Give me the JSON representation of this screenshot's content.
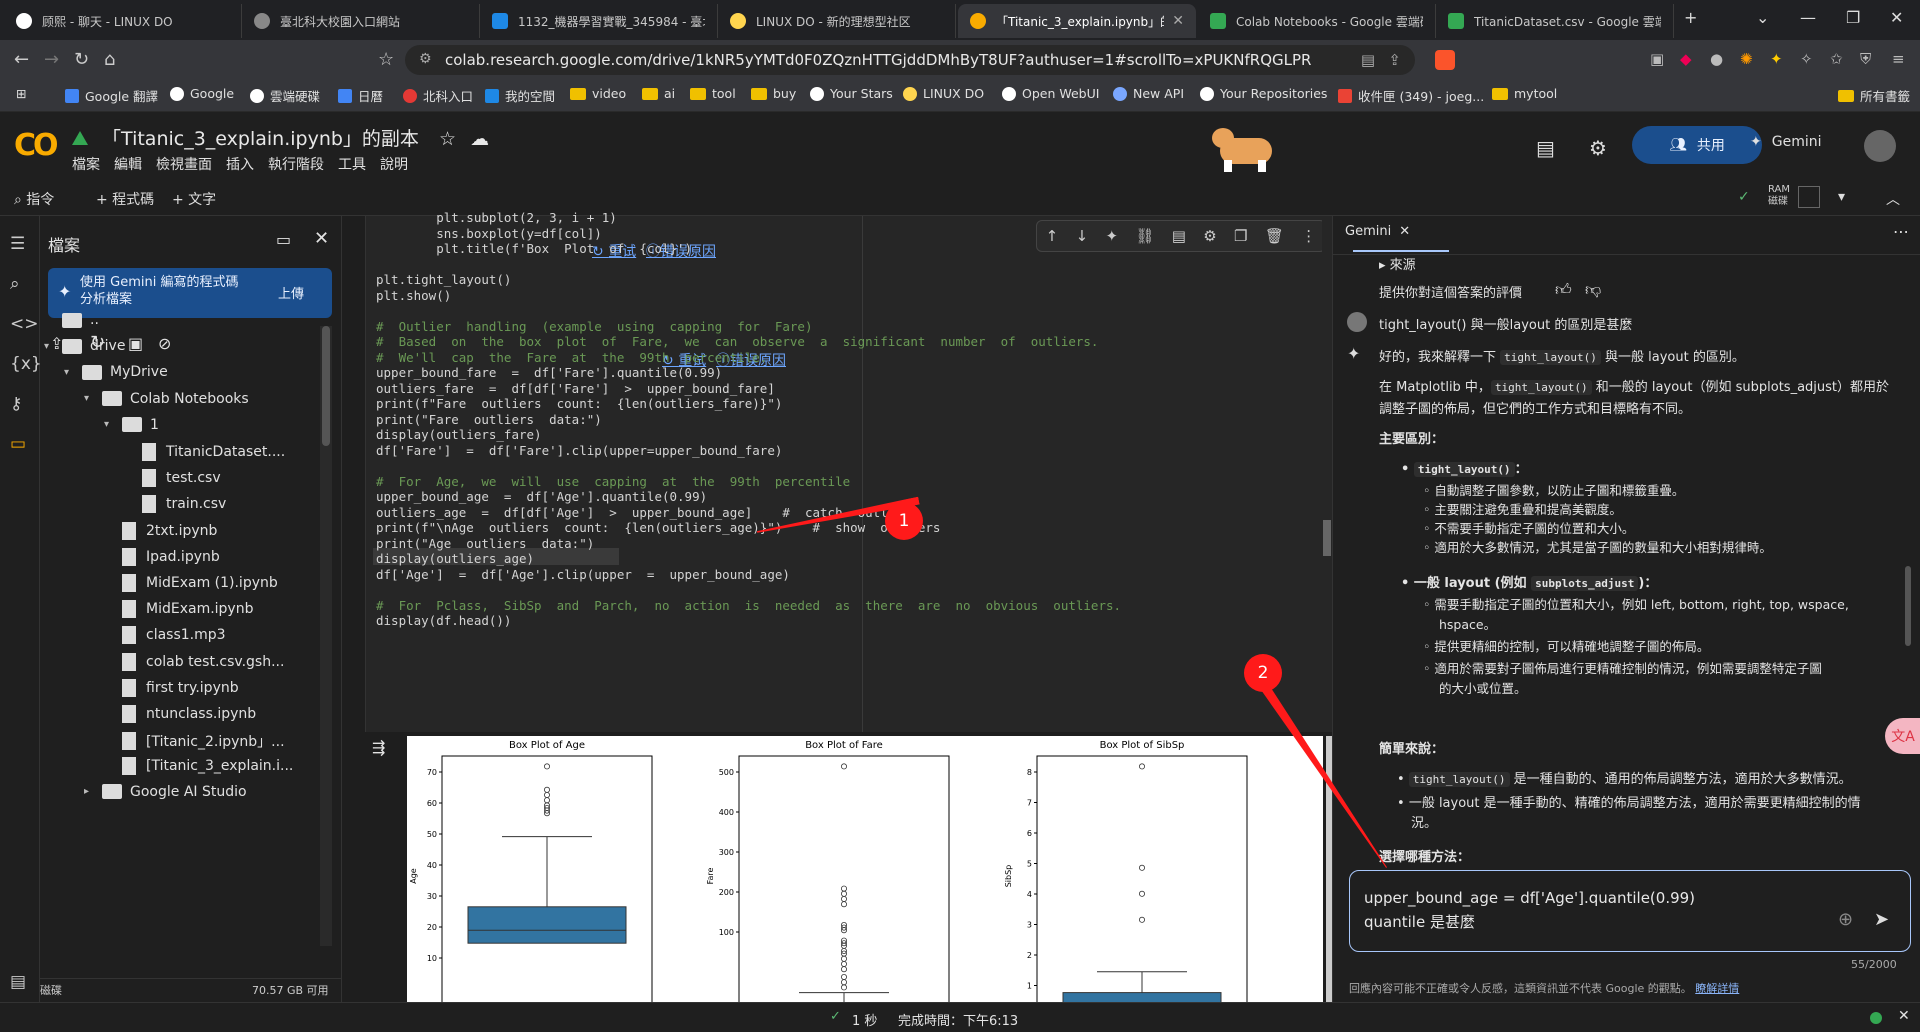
{
  "browser": {
    "tabs": [
      {
        "title": "顾熙 - 聊天 - LINUX DO",
        "color": "#ffffff"
      },
      {
        "title": "臺北科大校園入口網站",
        "color": "#888888"
      },
      {
        "title": "1132_機器學習實戰_345984 - 臺北",
        "color": "#1e88e5"
      },
      {
        "title": "LINUX DO - 新的理想型社区",
        "color": "#ffd54f"
      },
      {
        "title": "「Titanic_3_explain.ipynb」的",
        "color": "#f9ab00"
      },
      {
        "title": "Colab Notebooks - Google 雲端硬",
        "color": "#34a853"
      },
      {
        "title": "TitanicDataset.csv - Google 雲端硬",
        "color": "#34a853"
      }
    ],
    "url": "colab.research.google.com/drive/1kNR5yYMTd0F0ZQznHTTGjddDMhByT8UF?authuser=1#scrollTo=xPUKNfRQGLPR",
    "bookmarks": [
      "Google 翻譯",
      "Google",
      "雲端硬碟",
      "日曆",
      "北科入口",
      "我的空間",
      "video",
      "ai",
      "tool",
      "buy",
      "Your Stars",
      "LINUX DO",
      "Open WebUI",
      "New API",
      "Your Repositories",
      "收件匣 (349) - joeg...",
      "mytool"
    ],
    "bookmarks_right": "所有書籤"
  },
  "colab": {
    "title": "「Titanic_3_explain.ipynb」的副本",
    "menu": [
      "檔案",
      "編輯",
      "檢視畫面",
      "插入",
      "執行階段",
      "工具",
      "說明"
    ],
    "share": "共用",
    "gemini_btn": "Gemini",
    "toolbar": {
      "commands": "指令",
      "add_code": "+ 程式碼",
      "add_text": "+ 文字",
      "ram": "RAM",
      "disk": "磁碟"
    }
  },
  "files": {
    "title": "檔案",
    "upload_text_1": "使用 Gemini 編寫的程式碼",
    "upload_text_2": "分析檔案",
    "upload_btn": "上傳",
    "tree": [
      {
        "name": "..",
        "type": "folder",
        "indent": 0
      },
      {
        "name": "drive",
        "type": "folder",
        "indent": 0
      },
      {
        "name": "MyDrive",
        "type": "folder",
        "indent": 1
      },
      {
        "name": "Colab Notebooks",
        "type": "folder",
        "indent": 2
      },
      {
        "name": "1",
        "type": "folder",
        "indent": 3
      },
      {
        "name": "TitanicDataset....",
        "type": "file",
        "indent": 4
      },
      {
        "name": "test.csv",
        "type": "file",
        "indent": 4
      },
      {
        "name": "train.csv",
        "type": "file",
        "indent": 4
      },
      {
        "name": "2txt.ipynb",
        "type": "file",
        "indent": 3
      },
      {
        "name": "Ipad.ipynb",
        "type": "file",
        "indent": 3
      },
      {
        "name": "MidExam (1).ipynb",
        "type": "file",
        "indent": 3
      },
      {
        "name": "MidExam.ipynb",
        "type": "file",
        "indent": 3
      },
      {
        "name": "class1.mp3",
        "type": "file",
        "indent": 3
      },
      {
        "name": "colab test.csv.gsh...",
        "type": "file",
        "indent": 3
      },
      {
        "name": "first try.ipynb",
        "type": "file",
        "indent": 3
      },
      {
        "name": "ntunclass.ipynb",
        "type": "file",
        "indent": 3
      },
      {
        "name": "[Titanic_2.ipynb」...",
        "type": "file",
        "indent": 3
      },
      {
        "name": "[Titanic_3_explain.i...",
        "type": "file",
        "indent": 3
      },
      {
        "name": "Google AI Studio",
        "type": "folder",
        "indent": 2
      }
    ],
    "disk_label": "磁碟",
    "disk_free": "70.57 GB 可用"
  },
  "code": {
    "lines": [
      "        plt.subplot(2, 3, i + 1)",
      "        sns.boxplot(y=df[col])",
      "        plt.title(f'Box  Plot  of  {col}')",
      "",
      "plt.tight_layout()",
      "plt.show()",
      "",
      "#  Outlier  handling  (example  using  capping  for  Fare)",
      "#  Based  on  the  box  plot  of  Fare,  we  can  observe  a  significant  number  of  outliers.",
      "#  We'll  cap  the  Fare  at  the  99th  percentile.",
      "upper_bound_fare  =  df['Fare'].quantile(0.99)",
      "outliers_fare  =  df[df['Fare']  >  upper_bound_fare]",
      "print(f\"Fare  outliers  count:  {len(outliers_fare)}\")",
      "print(\"Fare  outliers  data:\")",
      "display(outliers_fare)",
      "df['Fare']  =  df['Fare'].clip(upper=upper_bound_fare)",
      "",
      "#  For  Age,  we  will  use  capping  at  the  99th  percentile",
      "upper_bound_age  =  df['Age'].quantile(0.99)",
      "outliers_age  =  df[df['Age']  >  upper_bound_age]    #  catch  outliers",
      "print(f\"\\nAge  outliers  count:  {len(outliers_age)}\")    #  show  outliers",
      "print(\"Age  outliers  data:\")",
      "display(outliers_age)",
      "df['Age']  =  df['Age'].clip(upper  =  upper_bound_age)",
      "",
      "#  For  Pclass,  SibSp  and  Parch,  no  action  is  needed  as  there  are  no  obvious  outliers.",
      "display(df.head())"
    ],
    "retry": "重试",
    "explain": "错误原因",
    "annotation_1": "1",
    "annotation_2": "2"
  },
  "output_plots": [
    {
      "title": "Box Plot of Age",
      "ylabel": "Age",
      "ticks": [
        "70",
        "60",
        "50",
        "40",
        "30",
        "20",
        "10"
      ]
    },
    {
      "title": "Box Plot of Fare",
      "ylabel": "Fare",
      "ticks": [
        "500",
        "400",
        "300",
        "200",
        "100"
      ]
    },
    {
      "title": "Box Plot of SibSp",
      "ylabel": "SibSp",
      "ticks": [
        "8",
        "7",
        "6",
        "5",
        "4",
        "3",
        "2",
        "1"
      ]
    }
  ],
  "gemini": {
    "tab": "Gemini",
    "source": "▸ 來源",
    "feedback": "提供你對這個答案的評價",
    "user_q": "tight_layout() 與一般layout 的區別是甚麼",
    "a_intro_pre": "好的，我來解釋一下",
    "a_intro_code": "tight_layout()",
    "a_intro_post": "與一般 layout 的區別。",
    "a_p2_pre": "在 Matplotlib 中，",
    "a_p2_code": "tight_layout()",
    "a_p2_post": "和一般的 layout（例如 subplots_adjust）都用於",
    "a_p2_line2": "調整子圖的佈局，但它們的工作方式和目標略有不同。",
    "h_main": "主要區別：",
    "b1_code": "tight_layout()",
    "b1_items": [
      "自動調整子圖參數，以防止子圖和標籤重疊。",
      "主要關注避免重疊和提高美觀度。",
      "不需要手動指定子圖的位置和大小。",
      "適用於大多數情況，尤其是當子圖的數量和大小相對規律時。"
    ],
    "b2_pre": "一般 layout (例如",
    "b2_code": "subplots_adjust",
    "b2_items": [
      "需要手動指定子圖的位置和大小，例如 left, bottom, right, top, wspace,",
      "hspace。",
      "提供更精細的控制，可以精確地調整子圖的佈局。",
      "適用於需要對子圖佈局進行更精確控制的情況，例如需要調整特定子圖",
      "的大小或位置。"
    ],
    "h_simple": "簡單來說：",
    "s1_code": "tight_layout()",
    "s1_post": "是一種自動的、通用的佈局調整方法，適用於大多數情況。",
    "s2": "一般 layout 是一種手動的、精確的佈局調整方法，適用於需要更精細控制的情",
    "s2b": "況。",
    "h_choose": "選擇哪種方法：",
    "input_line1": "upper_bound_age = df['Age'].quantile(0.99)",
    "input_line2": "quantile 是甚麼",
    "counter": "55/2000",
    "disclaimer": "回應內容可能不正確或令人反感，這類資訊並不代表 Google 的觀點。",
    "learn_more": "瞭解詳情"
  },
  "status": {
    "time": "1 秒",
    "done": "完成時間：下午6:13"
  }
}
